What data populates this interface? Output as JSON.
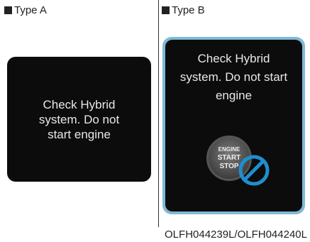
{
  "type_a": {
    "label": "Type A",
    "message": "Check Hybrid system. Do not start engine"
  },
  "type_b": {
    "label": "Type B",
    "message": "Check Hybrid system. Do not start engine",
    "button": {
      "line1": "ENGINE",
      "line2": "START",
      "line3": "STOP"
    },
    "icon": "no-entry-icon"
  },
  "caption": "OLFH044239L/OLFH044240L",
  "colors": {
    "screen": "#0c0c0c",
    "frame_b": "#7fb9d6",
    "no_symbol": "#1e8fd0"
  }
}
